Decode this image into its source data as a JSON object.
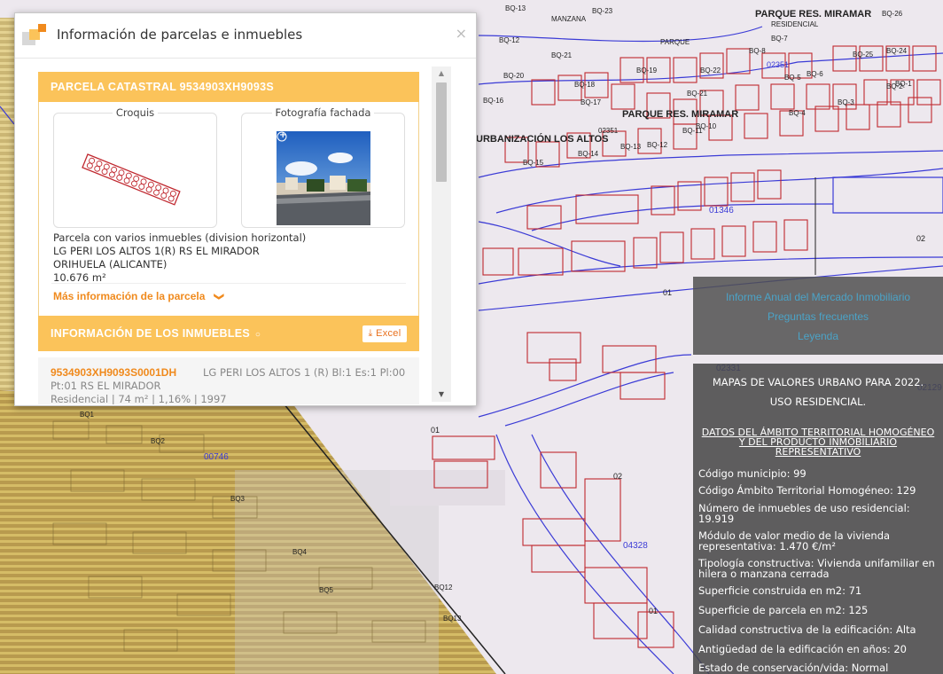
{
  "map": {
    "labels": [
      "PARQUE RES. MIRAMAR",
      "RESIDENCIAL",
      "PARQUE",
      "PARQUE RES. MIRAMAR",
      "URBANIZACIÓN LOS ALTOS",
      "MANZANA",
      "02351",
      "02351",
      "01346",
      "04328",
      "02",
      "01",
      "01",
      "02",
      "01",
      "00746",
      "02129",
      "02331",
      "BQ-13",
      "BQ-23",
      "BQ-12",
      "BQ-21",
      "BQ-20",
      "BQ-19",
      "BQ-18",
      "BQ-17",
      "BQ-16",
      "BQ-15",
      "BQ-14",
      "BQ-13",
      "BQ-12",
      "BQ-11",
      "BQ-10",
      "BQ-22",
      "BQ-21",
      "BQ-24",
      "BQ-25",
      "BQ-26",
      "BQ-8",
      "BQ-7",
      "BQ-6",
      "BQ-5",
      "BQ-4",
      "BQ-3",
      "BQ-2",
      "BQ-1",
      "BQ1",
      "BQ2",
      "BQ3",
      "BQ4",
      "BQ5",
      "BQ12",
      "BQ13"
    ]
  },
  "dialog": {
    "title": "Información de parcelas e inmuebles",
    "close_icon": "×",
    "parcela": {
      "header": "PARCELA CATASTRAL 9534903XH9093S",
      "croquis_label": "Croquis",
      "foto_label": "Fotografía fachada",
      "zoom_icon": "+",
      "lines": [
        "Parcela con varios inmuebles (division horizontal)",
        "LG PERI LOS ALTOS 1(R) RS EL MIRADOR",
        "ORIHUELA (ALICANTE)",
        "10.676 m²"
      ],
      "more_info": "Más información de la parcela",
      "chevron": "❯"
    },
    "inmuebles": {
      "header": "INFORMACIÓN DE LOS INMUEBLES",
      "comment_icon": "💬",
      "excel_label": "Excel",
      "excel_icon": "⤓",
      "row": {
        "ref": "9534903XH9093S0001DH",
        "addr1": "LG PERI LOS ALTOS 1 (R) Bl:1 Es:1 Pl:00",
        "addr2": "Pt:01 RS EL MIRADOR",
        "meta": "Residencial | 74 m² | 1,16% | 1997"
      }
    },
    "scroll": {
      "up": "▲",
      "down": "▼"
    }
  },
  "links": [
    "Informe Anual del Mercado Inmobiliario",
    "Preguntas frecuentes",
    "Leyenda"
  ],
  "panel": {
    "title_line1": "MAPAS DE VALORES URBANO PARA 2022.",
    "title_line2": "USO RESIDENCIAL.",
    "subtitle_line1": "DATOS DEL ÁMBITO TERRITORIAL HOMOGÉNEO",
    "subtitle_line2": "Y DEL PRODUCTO INMOBILIARIO",
    "subtitle_line3": "REPRESENTATIVO",
    "rows": [
      [
        "Código municipio: 99"
      ],
      [
        "Código Ámbito Territorial Homogéneo: 129"
      ],
      [
        "Número de inmuebles de uso residencial:",
        "19.919"
      ],
      [
        "Módulo de valor medio de la vivienda",
        "representativa: 1.470 €/m²"
      ],
      [
        "Tipología constructiva: Vivienda unifamiliar en",
        "hilera o manzana cerrada"
      ],
      [
        "Superficie construida en m2: 71"
      ],
      [
        "Superficie de parcela en m2: 125"
      ],
      [
        "Calidad constructiva de la edificación: Alta"
      ],
      [
        "Antigüedad de la edificación en años: 20"
      ],
      [
        "Estado de conservación/vida: Normal"
      ]
    ]
  },
  "colors": {
    "accent": "#fbc35a",
    "orange": "#f08a1d",
    "map_bg": "#efe9ef",
    "parcel_red": "#c0282f",
    "road_blue": "#3b3bd6"
  }
}
